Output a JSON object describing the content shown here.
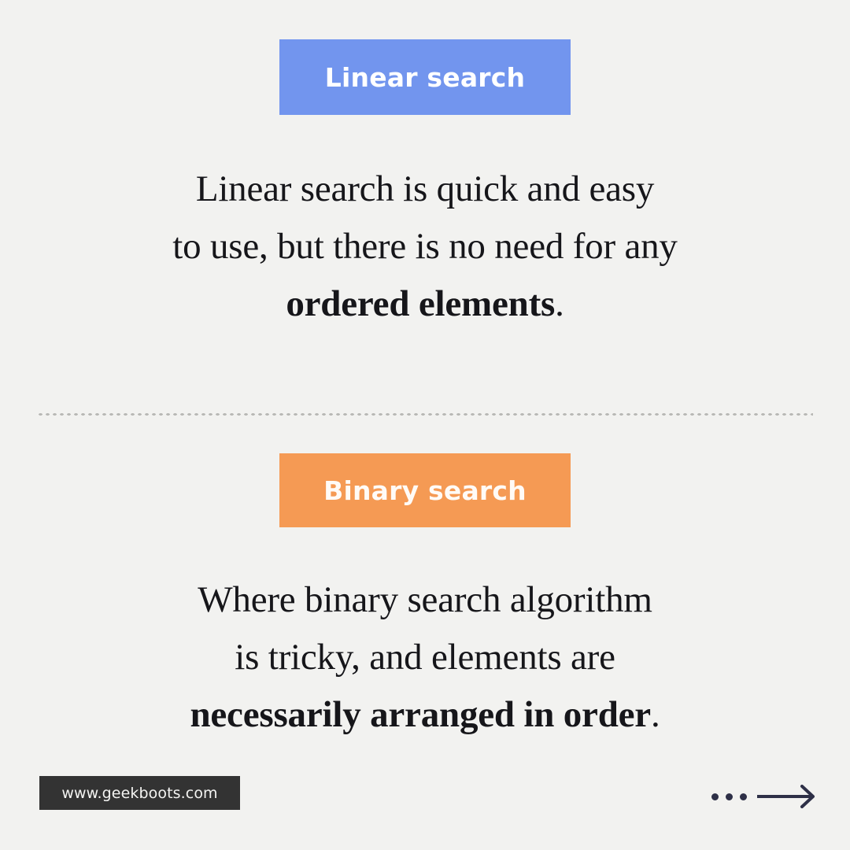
{
  "background_color": "#F2F2F0",
  "sections": [
    {
      "badge": {
        "label": "Linear search",
        "background_color": "#7295EE",
        "text_color": "#FFFFFF"
      },
      "paragraph": {
        "line1": "Linear search is quick and easy",
        "line2": "to use, but there is no need for any",
        "line3_bold": "ordered elements",
        "line3_tail": "."
      }
    },
    {
      "badge": {
        "label": "Binary search",
        "background_color": "#F59A54",
        "text_color": "#FFFBF7"
      },
      "paragraph": {
        "line1": "Where binary search algorithm",
        "line2": "is tricky, and elements are",
        "line3_bold": "necessarily arranged in order",
        "line3_tail": "."
      }
    }
  ],
  "divider": {
    "style": "dotted",
    "color": "#B9B9B6"
  },
  "footer": {
    "url_badge": {
      "label": "www.geekboots.com",
      "background_color": "#333333",
      "text_color": "#F4F4F2"
    },
    "next_control": {
      "icon": "three-dots-arrow-right-icon",
      "color": "#2E3047",
      "dot_count": 3
    }
  }
}
